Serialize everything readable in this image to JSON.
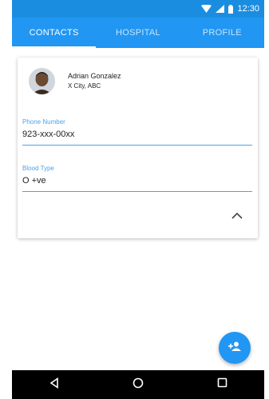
{
  "status_bar": {
    "time": "12:30"
  },
  "tabs": [
    {
      "label": "CONTACTS",
      "active": true
    },
    {
      "label": "HOSPITAL",
      "active": false
    },
    {
      "label": "PROFILE",
      "active": false
    }
  ],
  "contact_card": {
    "name": "Adrian Gonzalez",
    "location": "X City, ABC",
    "phone": {
      "label": "Phone Number",
      "value": "923-xxx-00xx"
    },
    "blood": {
      "label": "Blood Type",
      "value": "O +ve"
    },
    "collapse_icon": "chevron-up-icon"
  },
  "fab": {
    "icon": "add-person-icon"
  },
  "nav_bar": {
    "icons": [
      "back-icon",
      "home-icon",
      "recents-icon"
    ]
  },
  "colors": {
    "primary": "#2196f3",
    "status_bar": "#1a8de0",
    "accent_text": "#4aa3ec"
  }
}
